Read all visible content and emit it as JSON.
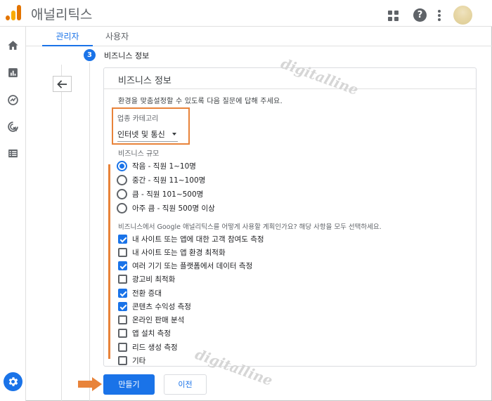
{
  "app": {
    "title": "애널리틱스"
  },
  "tabs": [
    {
      "label": "관리자",
      "active": true
    },
    {
      "label": "사용자",
      "active": false
    }
  ],
  "step": {
    "number": "3",
    "label": "비즈니스 정보"
  },
  "card": {
    "title": "비즈니스 정보",
    "intro": "환경을 맞춤설정할 수 있도록 다음 질문에 답해 주세요.",
    "industry": {
      "label": "업종 카테고리",
      "value": "인터넷 및 통신"
    },
    "size": {
      "label": "비즈니스 규모",
      "options": [
        {
          "label": "작음 - 직원 1~10명",
          "selected": true
        },
        {
          "label": "중간 - 직원 11~100명",
          "selected": false
        },
        {
          "label": "큼 - 직원 101~500명",
          "selected": false
        },
        {
          "label": "아주 큼 - 직원 500명 이상",
          "selected": false
        }
      ]
    },
    "usage": {
      "label": "비즈니스에서 Google 애널리틱스를 어떻게 사용할 계획인가요? 해당 사항을 모두 선택하세요.",
      "options": [
        {
          "label": "내 사이트 또는 앱에 대한 고객 참여도 측정",
          "checked": true
        },
        {
          "label": "내 사이트 또는 앱 환경 최적화",
          "checked": false
        },
        {
          "label": "여러 기기 또는 플랫폼에서 데이터 측정",
          "checked": true
        },
        {
          "label": "광고비 최적화",
          "checked": false
        },
        {
          "label": "전환 증대",
          "checked": true
        },
        {
          "label": "콘텐츠 수익성 측정",
          "checked": true
        },
        {
          "label": "온라인 판매 분석",
          "checked": false
        },
        {
          "label": "앱 설치 측정",
          "checked": false
        },
        {
          "label": "리드 생성 측정",
          "checked": false
        },
        {
          "label": "기타",
          "checked": false
        }
      ]
    }
  },
  "buttons": {
    "create": "만들기",
    "previous": "이전"
  },
  "watermark": "digitalline",
  "colors": {
    "primary": "#1a73e8",
    "highlight": "#e8833a",
    "logo_orange": "#e37400",
    "logo_yellow": "#f9ab00"
  },
  "icons": [
    "analytics-logo-icon",
    "apps-grid-icon",
    "help-icon",
    "more-vert-icon",
    "home-icon",
    "reports-icon",
    "explore-icon",
    "advertising-icon",
    "configure-icon",
    "settings-gear-icon",
    "arrow-back-icon"
  ]
}
